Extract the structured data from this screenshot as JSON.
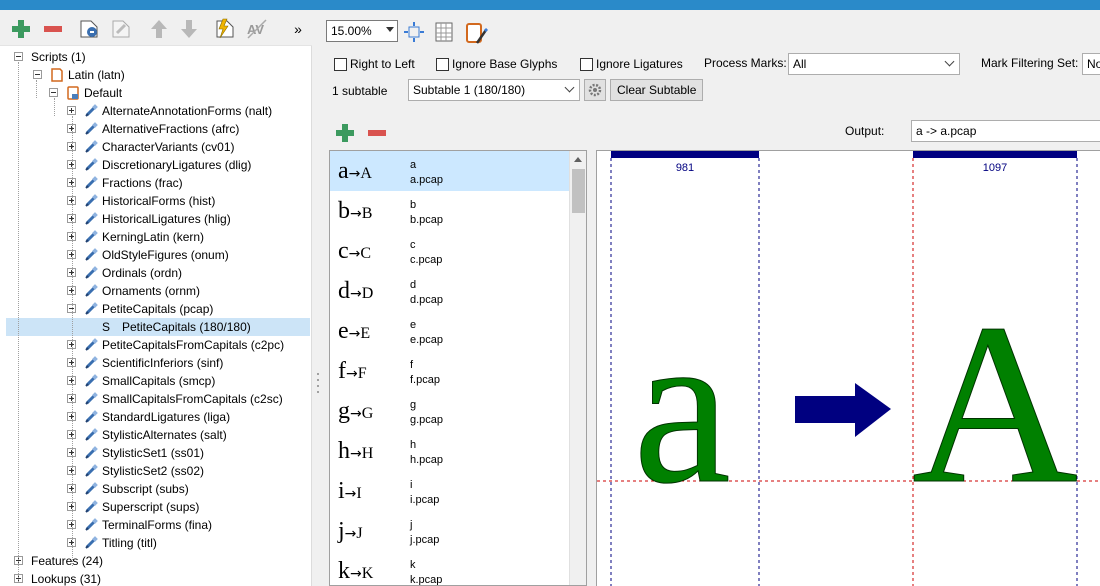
{
  "left_tree": {
    "scripts": "Scripts (1)",
    "latin": "Latin (latn)",
    "default": "Default",
    "features": [
      "AlternateAnnotationForms (nalt)",
      "AlternativeFractions (afrc)",
      "CharacterVariants (cv01)",
      "DiscretionaryLigatures (dlig)",
      "Fractions (frac)",
      "HistoricalForms (hist)",
      "HistoricalLigatures (hlig)",
      "KerningLatin (kern)",
      "OldStyleFigures (onum)",
      "Ordinals (ordn)",
      "Ornaments (ornm)",
      "PetiteCapitals (pcap)"
    ],
    "selected_subtable": "PetiteCapitals (180/180)",
    "selected_subtable_prefix": "S",
    "features_after": [
      "PetiteCapitalsFromCapitals (c2pc)",
      "ScientificInferiors (sinf)",
      "SmallCapitals (smcp)",
      "SmallCapitalsFromCapitals (c2sc)",
      "StandardLigatures (liga)",
      "StylisticAlternates (salt)",
      "StylisticSet1 (ss01)",
      "StylisticSet2 (ss02)",
      "Subscript (subs)",
      "Superscript (sups)",
      "TerminalForms (fina)",
      "Titling (titl)"
    ],
    "features_root": "Features (24)",
    "lookups_root": "Lookups (31)"
  },
  "toolbar": {
    "overflow": "»",
    "zoom": "15.00%"
  },
  "options": {
    "right_to_left": "Right to Left",
    "ignore_base_glyphs": "Ignore Base Glyphs",
    "ignore_ligatures": "Ignore Ligatures",
    "process_marks_label": "Process Marks:",
    "process_marks_value": "All",
    "mark_filtering_label": "Mark Filtering Set:",
    "mark_filtering_value": "No",
    "subtable_count": "1 subtable",
    "subtable_value": "Subtable 1 (180/180)",
    "clear_subtable": "Clear Subtable",
    "output_label": "Output:",
    "output_value": "a -> a.pcap"
  },
  "glyph_pairs": [
    {
      "src": "a",
      "dst": "A",
      "input": "a",
      "output": "a.pcap"
    },
    {
      "src": "b",
      "dst": "B",
      "input": "b",
      "output": "b.pcap"
    },
    {
      "src": "c",
      "dst": "C",
      "input": "c",
      "output": "c.pcap"
    },
    {
      "src": "d",
      "dst": "D",
      "input": "d",
      "output": "d.pcap"
    },
    {
      "src": "e",
      "dst": "E",
      "input": "e",
      "output": "e.pcap"
    },
    {
      "src": "f",
      "dst": "F",
      "input": "f",
      "output": "f.pcap"
    },
    {
      "src": "g",
      "dst": "G",
      "input": "g",
      "output": "g.pcap"
    },
    {
      "src": "h",
      "dst": "H",
      "input": "h",
      "output": "h.pcap"
    },
    {
      "src": "i",
      "dst": "I",
      "input": "i",
      "output": "i.pcap"
    },
    {
      "src": "j",
      "dst": "J",
      "input": "j",
      "output": "j.pcap"
    },
    {
      "src": "k",
      "dst": "K",
      "input": "k",
      "output": "k.pcap"
    }
  ],
  "preview": {
    "advance_left": "981",
    "advance_right": "1097",
    "glyph_left": "a",
    "glyph_right": "A",
    "glyph_color": "#008000",
    "arrow_color": "#000080"
  },
  "colors": {
    "selection": "#cce4f7",
    "add_green": "#3c9a5f",
    "remove_red": "#d9534f"
  }
}
